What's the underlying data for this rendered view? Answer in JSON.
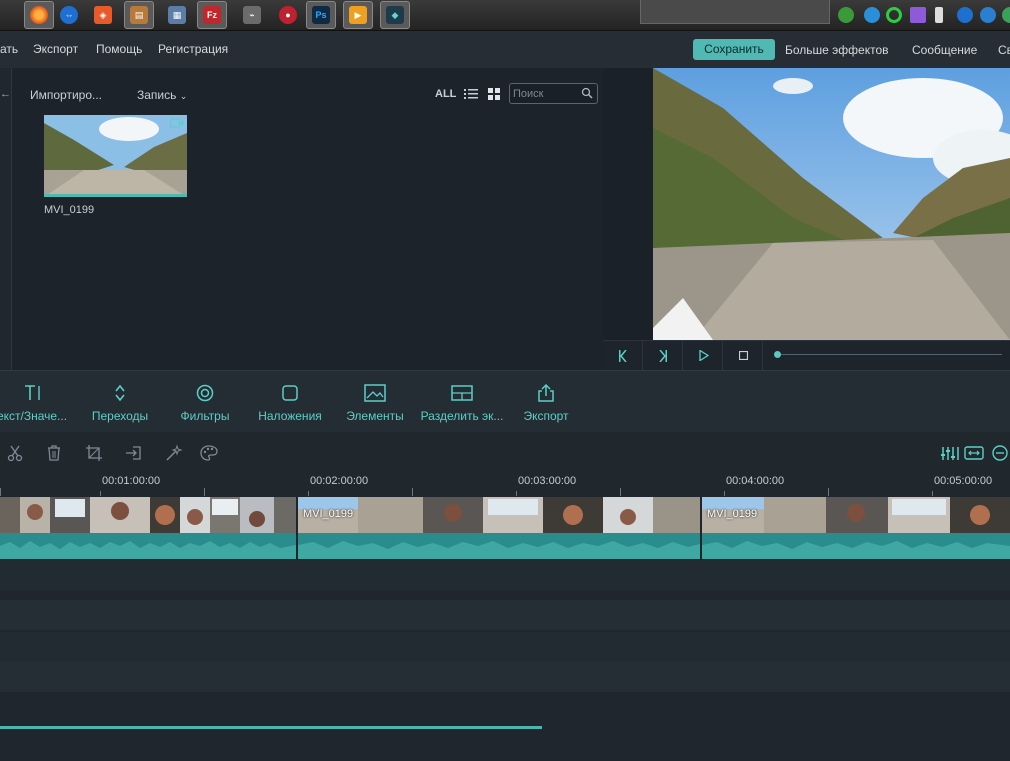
{
  "menubar": {
    "items": [
      "ать",
      "Экспорт",
      "Помощь",
      "Регистрация"
    ],
    "save_label": "Сохранить",
    "right_items": [
      "Больше эффектов",
      "Сообщение",
      "Св"
    ]
  },
  "media": {
    "import_label": "Импортиро...",
    "record_label": "Запись",
    "all_label": "ALL",
    "search_placeholder": "Поиск",
    "clip_name": "MVI_0199"
  },
  "tools": [
    {
      "label": "екст/Значе...",
      "icon": "text-icon"
    },
    {
      "label": "Переходы",
      "icon": "transitions-icon"
    },
    {
      "label": "Фильтры",
      "icon": "filters-icon"
    },
    {
      "label": "Наложения",
      "icon": "overlays-icon"
    },
    {
      "label": "Элементы",
      "icon": "elements-icon"
    },
    {
      "label": "Разделить эк...",
      "icon": "split-screen-icon"
    },
    {
      "label": "Экспорт",
      "icon": "export-icon"
    }
  ],
  "ruler": {
    "labels": [
      "00:01:00:00",
      "00:02:00:00",
      "00:03:00:00",
      "00:04:00:00",
      "00:05:00:00"
    ]
  },
  "timeline": {
    "clip_names": [
      "MVI_0199",
      "MVI_0199"
    ]
  },
  "colors": {
    "accent": "#50b9b3",
    "tool_label": "#5ccfc6",
    "background": "#1f262d"
  }
}
